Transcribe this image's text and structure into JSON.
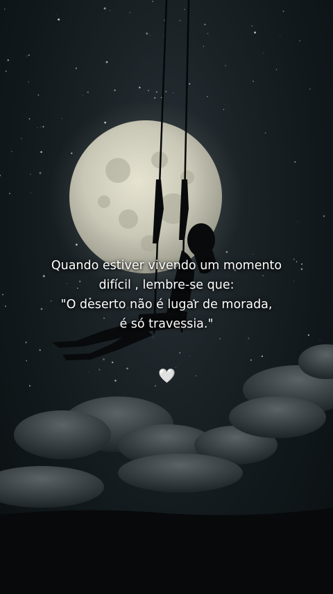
{
  "quote": {
    "lines": [
      "Quando estiver vivendo um momento",
      "difícil , lembre-se que:",
      "\"O deserto não é lugar de morada,",
      "é só travessia.\""
    ]
  },
  "decoration": {
    "icon": "white-heart-icon",
    "glyph": "🤍"
  },
  "scene": {
    "elements": [
      "starry-night-sky",
      "full-moon",
      "woman-on-swing",
      "clouds",
      "hill-silhouette"
    ],
    "colors": {
      "sky": "#11181b",
      "moon": "#d8d6c4",
      "clouds": "#3c4548",
      "text": "#ffffff"
    }
  }
}
